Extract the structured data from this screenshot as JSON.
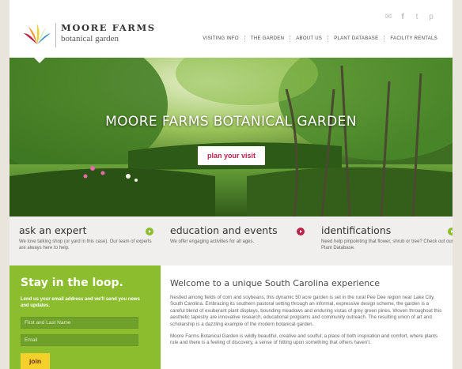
{
  "brand": {
    "name": "MOORE FARMS",
    "sub": "botanical garden"
  },
  "social": [
    "email-icon",
    "facebook-icon",
    "twitter-icon",
    "pinterest-icon"
  ],
  "nav": {
    "items": [
      {
        "label": "VISITING INFO"
      },
      {
        "label": "THE GARDEN"
      },
      {
        "label": "ABOUT US"
      },
      {
        "label": "PLANT DATABASE"
      },
      {
        "label": "FACILITY RENTALS"
      }
    ]
  },
  "hero": {
    "title": "MOORE FARMS BOTANICAL GARDEN",
    "cta": "plan your visit"
  },
  "features": [
    {
      "title": "ask an expert",
      "text": "We love talking shop (or yard in this case). Our team of experts are always here to help.",
      "color": "#8cbd2e"
    },
    {
      "title": "education and events",
      "text": "We offer engaging activities for all ages.",
      "color": "#b8234a"
    },
    {
      "title": "identifications",
      "text": "Need help pinpointing that flower, shrub or tree? Check out our Plant Database.",
      "color": "#8cbd2e"
    }
  ],
  "signup": {
    "title": "Stay in the loop.",
    "text": "Lend us your email address and we'll send you news and updates.",
    "name_placeholder": "First and Last Name",
    "email_placeholder": "Email",
    "button": "join"
  },
  "welcome": {
    "title": "Welcome to a unique South Carolina experience",
    "p1": "Nestled among fields of corn and soybeans, this dynamic 50 acre garden is set in the rural Pee Dee region near Lake City, South Carolina. Embracing its southern pastoral setting through an informal, expressive design scheme, the garden is a careful blend of exuberant plant displays, bounding meadows and enduring vistas of grey green pines. Woven throughout this aesthetic tapestry are innovative research, educational programs and community outreach. The resulting union of art and scholarship is a dazzling example of the modern botanical garden.",
    "p2": "Moore Farms Botanical Garden is wildly beautiful, creative and soulful; a place of both inspiration and comfort, where plants rule and there is a feeling of discovery, a sense of hitting upon something that others haven't."
  }
}
